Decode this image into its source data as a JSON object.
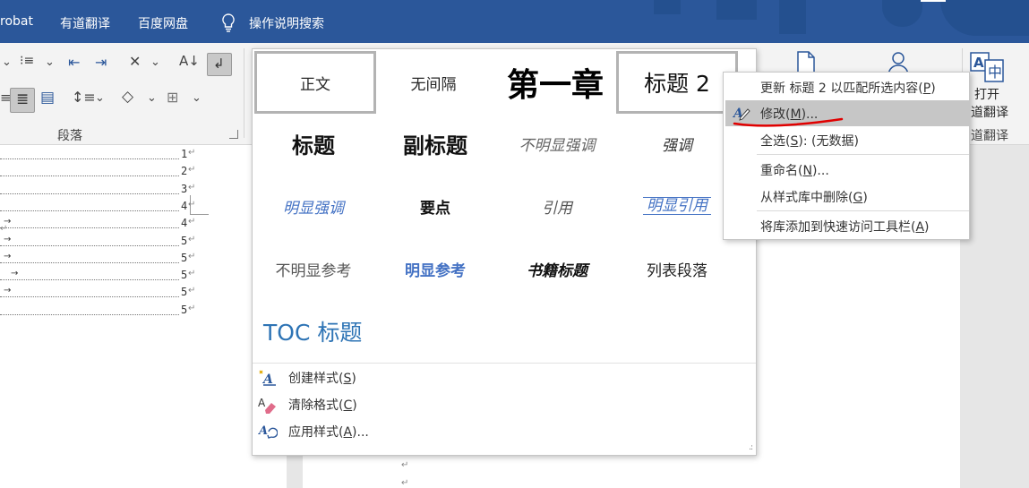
{
  "titlebar": {
    "menu": [
      "robat",
      "有道翻译",
      "百度网盘"
    ],
    "tell_me": "操作说明搜索"
  },
  "ribbon": {
    "paragraph_group_label": "段落",
    "open_translate": {
      "line1": "打开",
      "line2": "道翻译"
    },
    "translate_group_label": "道翻译"
  },
  "gallery": {
    "styles": [
      {
        "label": "正文",
        "selected": true
      },
      {
        "label": "无间隔"
      },
      {
        "label": "第一章"
      },
      {
        "label": "标题 2",
        "selected": true
      },
      {
        "label": "标题"
      },
      {
        "label": "副标题"
      },
      {
        "label": "不明显强调"
      },
      {
        "label": "强调"
      },
      {
        "label": "明显强调"
      },
      {
        "label": "要点"
      },
      {
        "label": "引用"
      },
      {
        "label": "明显引用"
      },
      {
        "label": "不明显参考"
      },
      {
        "label": "明显参考"
      },
      {
        "label": "书籍标题"
      },
      {
        "label": "列表段落"
      },
      {
        "label": "TOC 标题"
      }
    ],
    "commands": [
      {
        "text": "创建样式(",
        "key": "S",
        "tail": ")"
      },
      {
        "text": "清除格式(",
        "key": "C",
        "tail": ")"
      },
      {
        "text": "应用样式(",
        "key": "A",
        "tail": ")..."
      }
    ]
  },
  "context_menu": {
    "items": [
      {
        "text": "更新 标题 2 以匹配所选内容(",
        "key": "P",
        "tail": ")"
      },
      {
        "text": "修改(",
        "key": "M",
        "tail": ")...",
        "hovered": true
      },
      {
        "text": "全选(",
        "key": "S",
        "tail": "): (无数据)"
      },
      {
        "text": "重命名(",
        "key": "N",
        "tail": ")..."
      },
      {
        "text": "从样式库中删除(",
        "key": "G",
        "tail": ")"
      },
      {
        "text": "将库添加到快速访问工具栏(",
        "key": "A",
        "tail": ")"
      }
    ]
  },
  "document": {
    "toc_page_numbers": [
      "1",
      "2",
      "3",
      "4",
      "4",
      "5",
      "5",
      "5",
      "5",
      "5"
    ]
  },
  "colors": {
    "title_bar": "#2b579a",
    "accent_blue": "#4472c4",
    "menu_hover": "#c6c6c6",
    "annotation_red": "#e00000"
  }
}
